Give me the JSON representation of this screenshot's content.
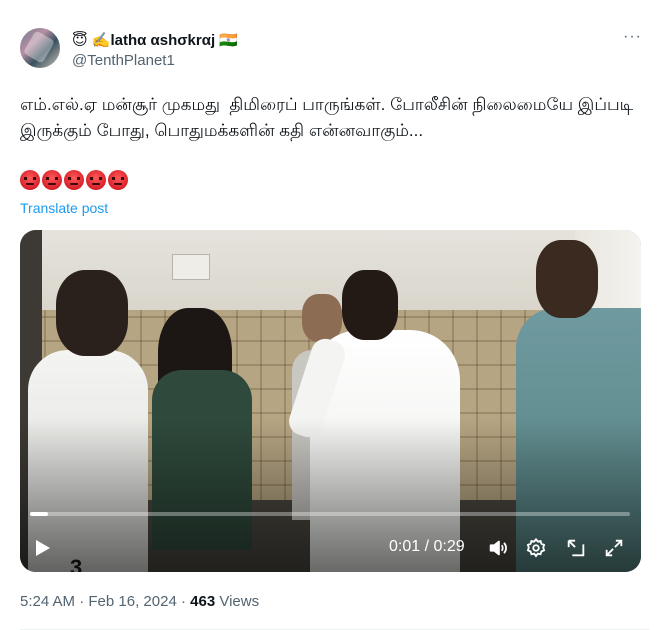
{
  "author": {
    "emoji_prefix": "😇",
    "pen_emoji": "✍️",
    "display_name": "lathα αshσkrαj",
    "flag": "🇮🇳",
    "handle": "@TenthPlanet1"
  },
  "more_menu": {
    "label": "···"
  },
  "tweet": {
    "text": "எம்.எல்.ஏ மன்சூர் முகமது  திமிரைப் பாருங்கள். போலீசின் நிலைமையே இப்படி இருக்கும் போது, பொதுமக்களின் கதி என்னவாகும்...",
    "reaction_emoji_count": 5,
    "reaction_emoji": "angry-face-icon",
    "translate_label": "Translate post"
  },
  "video": {
    "jersey_number": "3",
    "current_time": "0:01",
    "duration": "0:29",
    "time_display": "0:01 / 0:29",
    "progress_fraction": 0.03,
    "icons": [
      "play-icon",
      "volume-icon",
      "settings-icon",
      "picture-in-picture-icon",
      "fullscreen-icon"
    ]
  },
  "meta": {
    "time": "5:24 AM",
    "separator": "·",
    "date": "Feb 16, 2024",
    "views_count": "463",
    "views_label": "Views"
  },
  "colors": {
    "link": "#1d9bf0",
    "secondary_text": "#536471",
    "primary_text": "#0f1419"
  }
}
